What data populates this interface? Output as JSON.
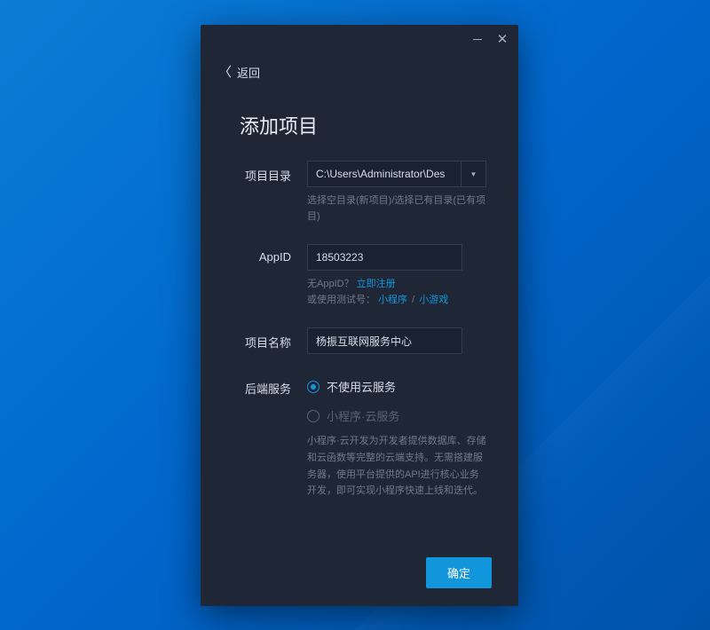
{
  "window": {
    "back_label": "返回"
  },
  "page": {
    "title": "添加项目"
  },
  "form": {
    "projectDir": {
      "label": "项目目录",
      "value": "C:\\Users\\Administrator\\Des",
      "hint": "选择空目录(新项目)/选择已有目录(已有项目)"
    },
    "appId": {
      "label": "AppID",
      "value": "18503223",
      "hint_prefix": "无AppID？",
      "hint_register": "立即注册",
      "hint_trial_prefix": "或使用测试号：",
      "hint_trial_miniapp": "小程序",
      "hint_trial_sep": "/",
      "hint_trial_game": "小游戏"
    },
    "projectName": {
      "label": "项目名称",
      "value": "杨振互联网服务中心"
    },
    "backend": {
      "label": "后端服务",
      "option_none": "不使用云服务",
      "option_cloud": "小程序·云服务",
      "selected": "none",
      "description": "小程序·云开发为开发者提供数据库、存储和云函数等完整的云端支持。无需搭建服务器，使用平台提供的API进行核心业务开发，即可实现小程序快速上线和迭代。"
    }
  },
  "buttons": {
    "confirm": "确定"
  }
}
